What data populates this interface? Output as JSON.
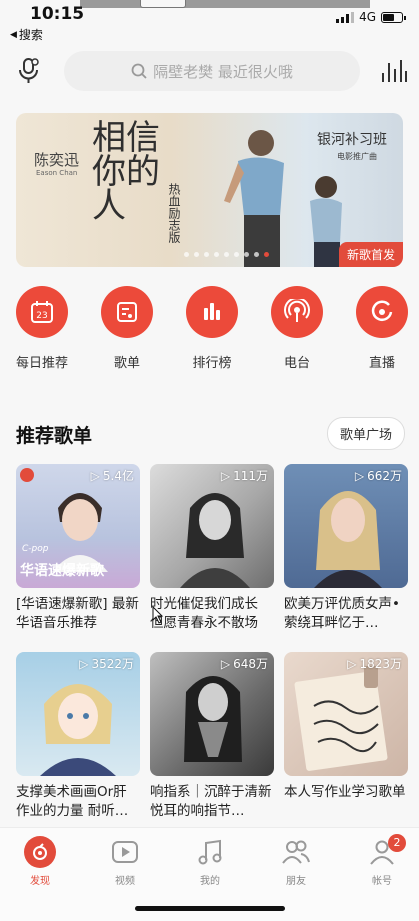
{
  "status_bar": {
    "time": "10:15",
    "network": "4G"
  },
  "back_nav": {
    "label": "搜索"
  },
  "search": {
    "placeholder": "隔壁老樊 最近很火哦"
  },
  "banner": {
    "artist_cn": "陈奕迅",
    "artist_en": "Eason Chan",
    "title": "相信你的人",
    "subtitle": "热血励志版",
    "film": "银河补习班",
    "film_sub": "电影推广曲",
    "tag": "新歌首发",
    "slides_total": 9,
    "active_slide": 9
  },
  "quick_entries": [
    {
      "label": "每日推荐",
      "icon": "calendar-icon",
      "day": "23"
    },
    {
      "label": "歌单",
      "icon": "playlist-icon"
    },
    {
      "label": "排行榜",
      "icon": "chart-bars-icon"
    },
    {
      "label": "电台",
      "icon": "radio-icon"
    },
    {
      "label": "直播",
      "icon": "live-icon"
    }
  ],
  "recommend": {
    "title": "推荐歌单",
    "more_button": "歌单广场",
    "playlists": [
      {
        "plays": "5.4亿",
        "title": "[华语速爆新歌] 最新华语音乐推荐",
        "cover_text": "华语速爆新歌",
        "cover_small": "C-pop"
      },
      {
        "plays": "111万",
        "title": "时光催促我们成长 但愿青春永不散场"
      },
      {
        "plays": "662万",
        "title": "欧美万评优质女声•萦绕耳畔忆于…"
      },
      {
        "plays": "3522万",
        "title": "支撑美术画画Or肝作业的力量 耐听…"
      },
      {
        "plays": "648万",
        "title": "响指系｜沉醉于清新悦耳的响指节…"
      },
      {
        "plays": "1823万",
        "title": "本人写作业学习歌单"
      }
    ]
  },
  "tabbar": {
    "tabs": [
      {
        "label": "发现",
        "icon": "discover-icon",
        "active": true
      },
      {
        "label": "视频",
        "icon": "video-icon"
      },
      {
        "label": "我的",
        "icon": "music-note-icon"
      },
      {
        "label": "朋友",
        "icon": "friends-icon"
      },
      {
        "label": "帐号",
        "icon": "account-icon",
        "badge": "2"
      }
    ]
  },
  "colors": {
    "accent": "#ec4a3a",
    "background": "#f7f7f7"
  }
}
